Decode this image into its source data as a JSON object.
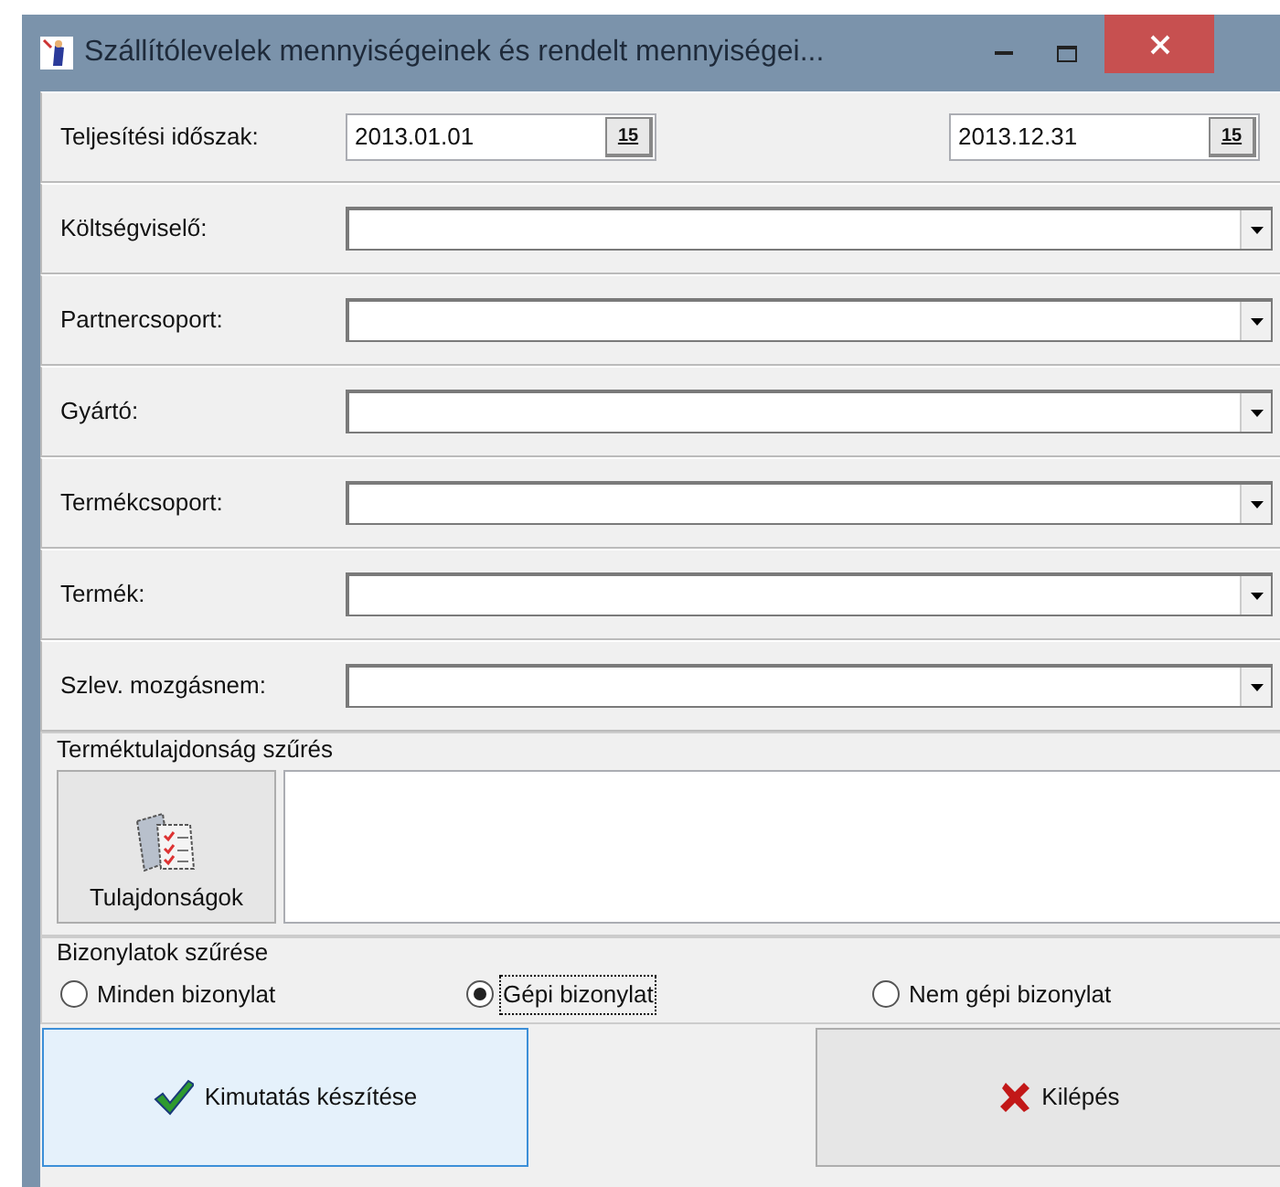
{
  "window": {
    "title": "Szállítólevelek mennyiségeinek és rendelt mennyiségei..."
  },
  "period": {
    "label": "Teljesítési időszak:",
    "from": "2013.01.01",
    "to": "2013.12.31",
    "from_calendar_glyph": "15",
    "to_calendar_glyph": "15"
  },
  "filters": [
    {
      "label": "Költségviselő:"
    },
    {
      "label": "Partnercsoport:"
    },
    {
      "label": "Gyártó:"
    },
    {
      "label": "Termékcsoport:"
    },
    {
      "label": "Termék:"
    },
    {
      "label": "Szlev. mozgásnem:"
    }
  ],
  "property_filter": {
    "title": "Terméktulajdonság szűrés",
    "button": "Tulajdonságok"
  },
  "document_filter": {
    "title": "Bizonylatok szűrése",
    "options": [
      {
        "label": "Minden bizonylat",
        "selected": false
      },
      {
        "label": "Gépi bizonylat",
        "selected": true
      },
      {
        "label": "Nem gépi bizonylat",
        "selected": false
      }
    ]
  },
  "buttons": [
    {
      "label": "Kimutatás készítése",
      "kind": "ok"
    },
    {
      "label": "Kilépés",
      "kind": "cancel"
    }
  ]
}
